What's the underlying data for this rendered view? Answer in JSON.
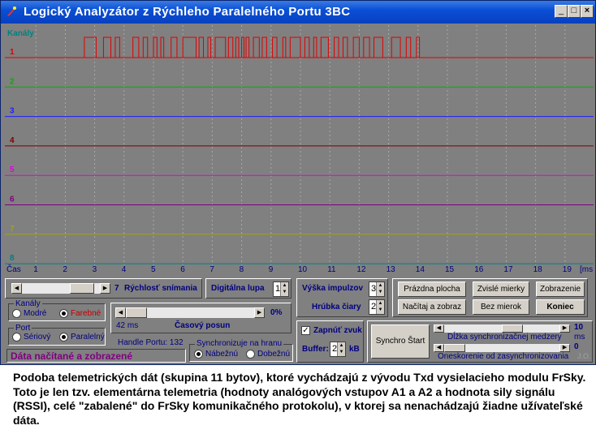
{
  "window": {
    "title": "Logický Analyzátor z Rýchleho Paralelného Portu 3BC",
    "buttons": [
      "_",
      "□",
      "×"
    ]
  },
  "plot": {
    "corner_label": "Kanály",
    "channels": [
      {
        "label": "1",
        "color": "#e00000"
      },
      {
        "label": "2",
        "color": "#00b000"
      },
      {
        "label": "3",
        "color": "#2020ff"
      },
      {
        "label": "4",
        "color": "#800000"
      },
      {
        "label": "5",
        "color": "#e000e0"
      },
      {
        "label": "6",
        "color": "#800080"
      },
      {
        "label": "7",
        "color": "#a0a020"
      },
      {
        "label": "8",
        "color": "#008080"
      }
    ],
    "time_label": "Čas",
    "time_ticks": [
      "1",
      "2",
      "3",
      "4",
      "5",
      "6",
      "7",
      "8",
      "9",
      "10",
      "11",
      "12",
      "13",
      "14",
      "15",
      "16",
      "17",
      "18",
      "19"
    ],
    "time_unit": "[ms",
    "channel1_pulses": [
      [
        2.65,
        3.05
      ],
      [
        3.3,
        3.55
      ],
      [
        3.7,
        3.85
      ],
      [
        4.3,
        4.5
      ],
      [
        4.65,
        4.8
      ],
      [
        5.0,
        5.12
      ],
      [
        5.25,
        5.35
      ],
      [
        5.6,
        5.8
      ],
      [
        6.0,
        6.45
      ],
      [
        6.55,
        6.7
      ],
      [
        6.85,
        6.95
      ],
      [
        7.1,
        7.45
      ],
      [
        7.55,
        7.7
      ],
      [
        7.8,
        7.9
      ],
      [
        8.0,
        8.08
      ],
      [
        8.15,
        8.25
      ],
      [
        8.4,
        8.6
      ],
      [
        8.7,
        8.85
      ],
      [
        9.05,
        9.2
      ],
      [
        9.4,
        9.5
      ],
      [
        9.65,
        10.0
      ],
      [
        10.15,
        10.3
      ],
      [
        10.45,
        10.55
      ],
      [
        10.7,
        10.95
      ],
      [
        11.15,
        11.3
      ],
      [
        11.45,
        11.6
      ],
      [
        11.8,
        12.0
      ],
      [
        12.15,
        12.35
      ],
      [
        12.5,
        12.8
      ],
      [
        13.1,
        13.4
      ],
      [
        13.6,
        13.75
      ],
      [
        13.95,
        14.05
      ]
    ]
  },
  "speed": {
    "value": "7",
    "label": "Rýchlosť snímania"
  },
  "zoom": {
    "label": "Digitálna lupa",
    "value": "1"
  },
  "pulse": {
    "height_label": "Výška impulzov",
    "height_value": "3",
    "width_label": "Hrúbka čiary",
    "width_value": "2"
  },
  "buttons": {
    "clear": "Prázdna plocha",
    "vgrid": "Zvislé mierky",
    "display": "Zobrazenie",
    "load": "Načítaj a zobraz",
    "nogrid": "Bez mierok",
    "end": "Koniec",
    "sync_start": "Synchro Štart"
  },
  "channels_group": {
    "title": "Kanály",
    "opt1": "Modré",
    "opt2": "Farebné"
  },
  "time_shift": {
    "percent": "0%",
    "ms": "42 ms",
    "label": "Časový posun"
  },
  "port_group": {
    "title": "Port",
    "opt1": "Sériový",
    "opt2": "Paralelný"
  },
  "handle": "Handle Portu: 132",
  "status": "Dáta načítané a zobrazené",
  "sync_edge": {
    "title": "Synchronizuje na hranu",
    "opt1": "Nábežnú",
    "opt2": "Dobežnú"
  },
  "sound": {
    "label": "Zapnúť zvuk",
    "checked": "✓"
  },
  "buffer": {
    "label": "Buffer:",
    "value": "2",
    "unit": "kB"
  },
  "sync_gap": {
    "value": "10",
    "label": "Dĺžka synchronizačnej medzery",
    "unit": "ms"
  },
  "sync_delay": {
    "value": "0",
    "label": "Oneskorenie od zasynchronizovania"
  },
  "signature": "J.O.",
  "caption": "Podoba telemetrických dát (skupina 11 bytov), ktoré vychádzajú z vývodu Txd vysielacieho modulu FrSky. Toto je len tzv. elementárna telemetria (hodnoty analógových vstupov A1 a A2 a hodnota sily signálu (RSSI), celé \"zabalené\" do FrSky komunikačného protokolu), v ktorej sa nenachádzajú žiadne užívateľské dáta."
}
